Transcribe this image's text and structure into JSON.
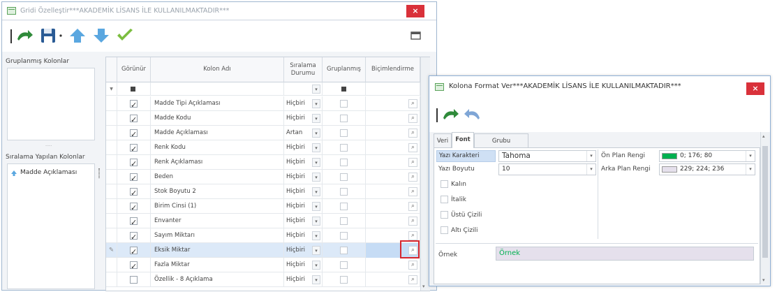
{
  "main_window": {
    "title": "Gridi Özelleştir***AKADEMİK LİSANS İLE KULLANILMAKTADIR***",
    "close": "×",
    "toolbar": {
      "icons": [
        "redo-arrow-icon",
        "save-disk-icon",
        "move-up-arrow-icon",
        "move-down-arrow-icon",
        "apply-check-icon",
        "window-icon"
      ]
    },
    "grouped_columns_label": "Gruplanmış Kolonlar",
    "dots": ".....",
    "sorted_columns_label": "Sıralama Yapılan Kolonlar",
    "sorted_columns": [
      "Madde Açıklaması"
    ],
    "grid": {
      "headers": [
        "Görünür",
        "Kolon Adı",
        "Sıralama Durumu",
        "Gruplanmış",
        "Biçimlendirme"
      ],
      "filter_row_marker": "▼",
      "active_row_marker": "✎",
      "rows": [
        {
          "visible": true,
          "name": "Madde Tipi Açıklaması",
          "sort": "Hiçbiri",
          "grouped": false
        },
        {
          "visible": true,
          "name": "Madde Kodu",
          "sort": "Hiçbiri",
          "grouped": false
        },
        {
          "visible": true,
          "name": "Madde Açıklaması",
          "sort": "Artan",
          "grouped": false
        },
        {
          "visible": true,
          "name": "Renk Kodu",
          "sort": "Hiçbiri",
          "grouped": false
        },
        {
          "visible": true,
          "name": "Renk Açıklaması",
          "sort": "Hiçbiri",
          "grouped": false
        },
        {
          "visible": true,
          "name": "Beden",
          "sort": "Hiçbiri",
          "grouped": false
        },
        {
          "visible": true,
          "name": "Stok Boyutu 2",
          "sort": "Hiçbiri",
          "grouped": false
        },
        {
          "visible": true,
          "name": "Birim Cinsi (1)",
          "sort": "Hiçbiri",
          "grouped": false
        },
        {
          "visible": true,
          "name": "Envanter",
          "sort": "Hiçbiri",
          "grouped": false
        },
        {
          "visible": true,
          "name": "Sayım Miktarı",
          "sort": "Hiçbiri",
          "grouped": false
        },
        {
          "visible": true,
          "name": "Eksik Miktar",
          "sort": "Hiçbiri",
          "grouped": false,
          "selected": true
        },
        {
          "visible": true,
          "name": "Fazla Miktar",
          "sort": "Hiçbiri",
          "grouped": false
        },
        {
          "visible": false,
          "name": "Özellik - 8 Açıklama",
          "sort": "Hiçbiri",
          "grouped": false
        }
      ]
    }
  },
  "format_dialog": {
    "title": "Kolona Format Ver***AKADEMİK LİSANS İLE KULLANILMAKTADIR***",
    "close": "×",
    "tabs": [
      "Veri",
      "Font",
      "Grubu Biçimlendir"
    ],
    "active_tab": "Font",
    "font_label": "Yazı Karakteri",
    "font_value": "Tahoma",
    "size_label": "Yazı Boyutu",
    "size_value": "10",
    "bold_label": "Kalın",
    "italic_label": "İtalik",
    "strike_label": "Üstü Çizili",
    "underline_label": "Altı Çizili",
    "fore_color_label": "Ön Plan Rengi",
    "fore_color_value": "0; 176; 80",
    "fore_color_hex": "#00b050",
    "back_color_label": "Arka Plan Rengi",
    "back_color_value": "229; 224; 236",
    "back_color_hex": "#e5e0ec",
    "sample_label": "Örnek",
    "sample_text": "Örnek"
  }
}
